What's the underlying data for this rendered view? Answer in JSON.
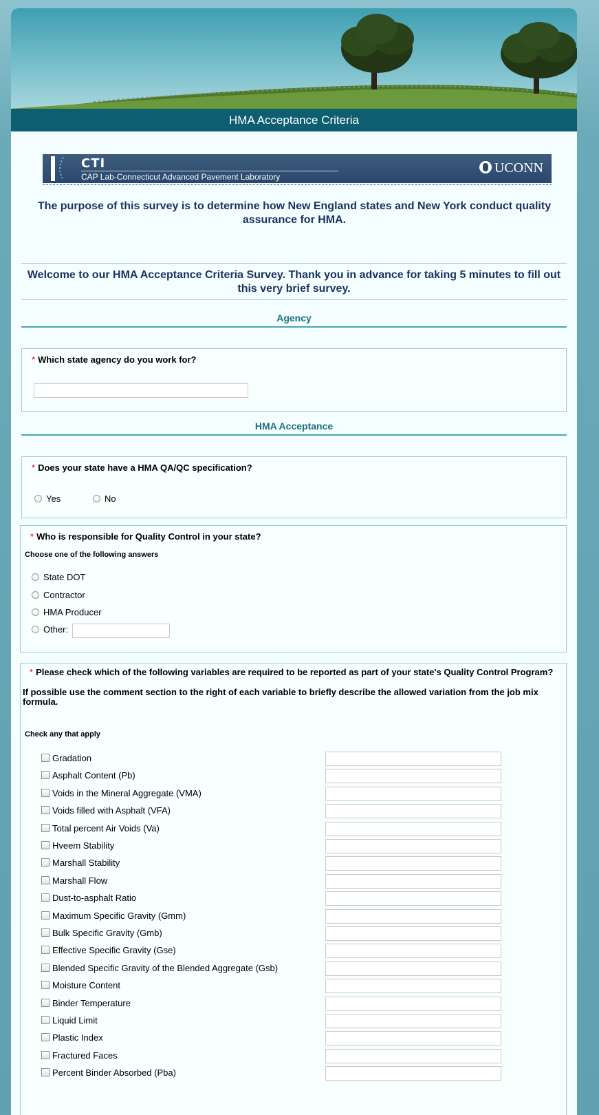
{
  "header": {
    "title": "HMA Acceptance Criteria"
  },
  "logo": {
    "name": "CTI",
    "subtitle": "CAP Lab-Connecticut Advanced Pavement Laboratory",
    "university": "UCONN"
  },
  "intro": {
    "purpose": "The purpose of this survey is to determine how New England states and New York conduct quality assurance for HMA.",
    "welcome": "Welcome to our HMA Acceptance Criteria Survey.  Thank you in advance for taking 5 minutes to fill out this very brief survey."
  },
  "sections": {
    "agency": "Agency",
    "acceptance": "HMA Acceptance"
  },
  "q1": {
    "required": "*",
    "question": "Which state agency do you work for?",
    "value": ""
  },
  "q2": {
    "required": "*",
    "question": "Does your state have a HMA QA/QC specification?",
    "options": [
      "Yes",
      "No"
    ]
  },
  "q3": {
    "required": "*",
    "question": "Who is responsible for Quality Control in your state?",
    "hint": "Choose one of the following answers",
    "options": [
      "State DOT",
      "Contractor",
      "HMA Producer",
      "Other:"
    ]
  },
  "q4": {
    "required": "*",
    "question": "Please check which of the following variables are required to be reported as part of your state's Quality Control Program?",
    "note": "If possible use the comment section to the right of each variable to briefly describe the allowed variation from the job mix formula.",
    "hint": "Check any that apply",
    "variables": [
      "Gradation",
      "Asphalt Content (Pb)",
      "Voids in the Mineral Aggregate (VMA)",
      "Voids filled with Asphalt (VFA)",
      "Total percent Air Voids (Va)",
      "Hveem Stability",
      "Marshall Stability",
      "Marshall Flow",
      "Dust-to-asphalt Ratio",
      "Maximum Specific Gravity (Gmm)",
      "Bulk Specific Gravity (Gmb)",
      "Effective Specific Gravity (Gse)",
      "Blended Specific Gravity of the Blended Aggregate (Gsb)",
      "Moisture Content",
      "Binder Temperature",
      "Liquid Limit",
      "Plastic Index",
      "Fractured Faces",
      "Percent Binder Absorbed (Pba)"
    ]
  }
}
